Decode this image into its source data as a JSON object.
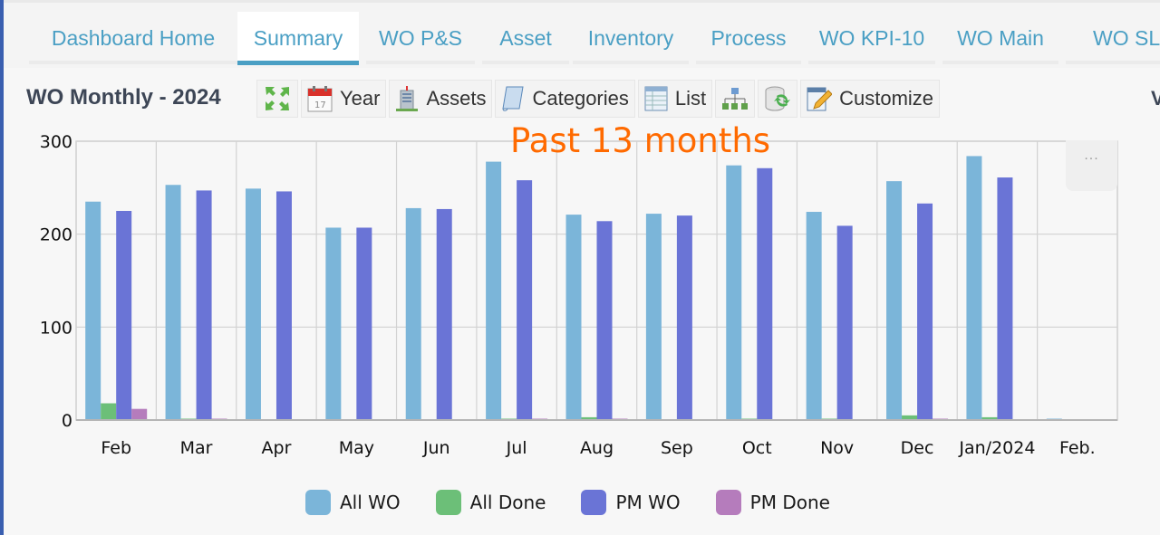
{
  "tabs": [
    {
      "label": "Dashboard Home",
      "active": false
    },
    {
      "label": "Summary",
      "active": true
    },
    {
      "label": "WO P&S",
      "active": false
    },
    {
      "label": "Asset",
      "active": false
    },
    {
      "label": "Inventory",
      "active": false
    },
    {
      "label": "Process",
      "active": false
    },
    {
      "label": "WO KPI-10",
      "active": false
    },
    {
      "label": "WO Main",
      "active": false
    },
    {
      "label": "WO SL",
      "active": false
    }
  ],
  "panel": {
    "title": "WO Monthly - 2024",
    "clipped_text": "V"
  },
  "toolbar": {
    "expand_icon": "expand-arrows-icon",
    "year_label": "Year",
    "year_icon": "calendar-icon",
    "assets_label": "Assets",
    "assets_icon": "building-icon",
    "categories_label": "Categories",
    "categories_icon": "scroll-icon",
    "list_label": "List",
    "list_icon": "table-list-icon",
    "hierarchy_icon": "hierarchy-icon",
    "refresh_icon": "database-refresh-icon",
    "customize_label": "Customize",
    "customize_icon": "edit-form-icon"
  },
  "annotation": "Past 13 months",
  "chart_menu": "...",
  "colors": {
    "tab_text": "#4a9fc4",
    "annotation": "#ff6a00",
    "all_wo": "#7bb5d9",
    "all_done": "#6cbf78",
    "pm_wo": "#6a74d6",
    "pm_done": "#b57cbc"
  },
  "chart_data": {
    "type": "bar",
    "title": "WO Monthly - 2024",
    "xlabel": "",
    "ylabel": "",
    "ylim": [
      0,
      300
    ],
    "yticks": [
      0,
      100,
      200,
      300
    ],
    "grid": true,
    "legend_position": "bottom",
    "categories": [
      "Feb",
      "Mar",
      "Apr",
      "May",
      "Jun",
      "Jul",
      "Aug",
      "Sep",
      "Oct",
      "Nov",
      "Dec",
      "Jan/2024",
      "Feb."
    ],
    "series": [
      {
        "name": "All WO",
        "color": "#7bb5d9",
        "values": [
          235,
          253,
          249,
          207,
          228,
          278,
          221,
          222,
          274,
          224,
          257,
          284,
          1
        ]
      },
      {
        "name": "All Done",
        "color": "#6cbf78",
        "values": [
          18,
          1,
          0,
          0,
          0,
          1,
          3,
          0,
          1,
          1,
          5,
          3,
          0
        ]
      },
      {
        "name": "PM WO",
        "color": "#6a74d6",
        "values": [
          225,
          247,
          246,
          207,
          227,
          258,
          214,
          220,
          271,
          209,
          233,
          261,
          0
        ]
      },
      {
        "name": "PM Done",
        "color": "#b57cbc",
        "values": [
          12,
          1,
          0,
          0,
          0,
          1,
          1,
          0,
          0,
          0,
          1,
          0,
          0
        ]
      }
    ]
  }
}
